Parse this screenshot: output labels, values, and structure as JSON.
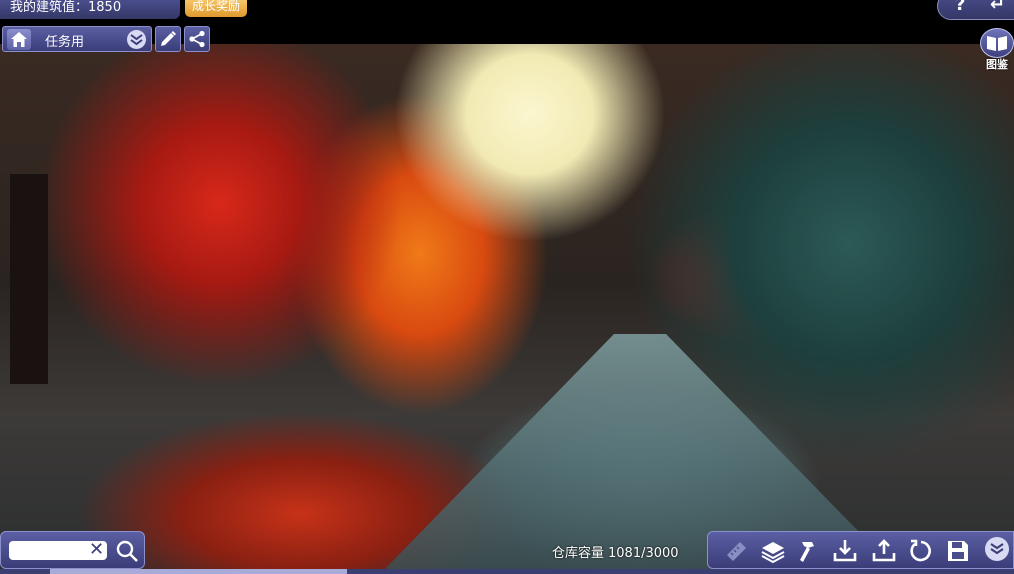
{
  "header": {
    "build_score_label": "我的建筑值：",
    "build_score_value": "1850",
    "growth_reward_label": "成长奖励"
  },
  "mode": {
    "current": "任务用"
  },
  "catalog": {
    "label": "图鉴"
  },
  "search": {
    "value": "",
    "placeholder": ""
  },
  "storage": {
    "label": "仓库容量",
    "used": 1081,
    "capacity": 3000,
    "display": "1081/3000"
  },
  "toolbar": {
    "icons": [
      "measure-ruler-icon",
      "layers-icon",
      "hammer-icon",
      "download-icon",
      "upload-icon",
      "rotate-icon",
      "save-icon",
      "chevron-down-icon"
    ]
  },
  "colors": {
    "panel": "#4a4e8c",
    "accent_gold": "#f0b24a",
    "text": "#ffffff"
  }
}
